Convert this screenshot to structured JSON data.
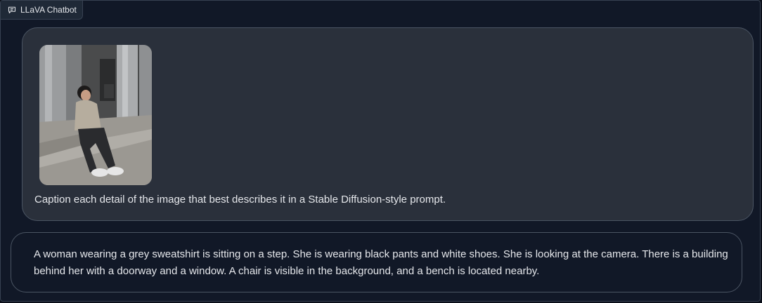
{
  "chatbot": {
    "label": "LLaVA Chatbot",
    "label_icon": "chat-bubble-icon"
  },
  "messages": {
    "user": {
      "image_icon": "photo-thumbnail",
      "text": "Caption each detail of the image that best describes it in a Stable Diffusion-style prompt."
    },
    "bot": {
      "text": "A woman wearing a grey sweatshirt is sitting on a step. She is wearing black pants and white shoes. She is looking at the camera. There is a building behind her with a doorway and a window. A chair is visible in the background, and a bench is located nearby."
    }
  },
  "colors": {
    "background": "#0b0f19",
    "panel": "#111827",
    "user_bubble": "#2a303b",
    "bubble_border": "#4b5563",
    "text": "#e5e7eb"
  }
}
